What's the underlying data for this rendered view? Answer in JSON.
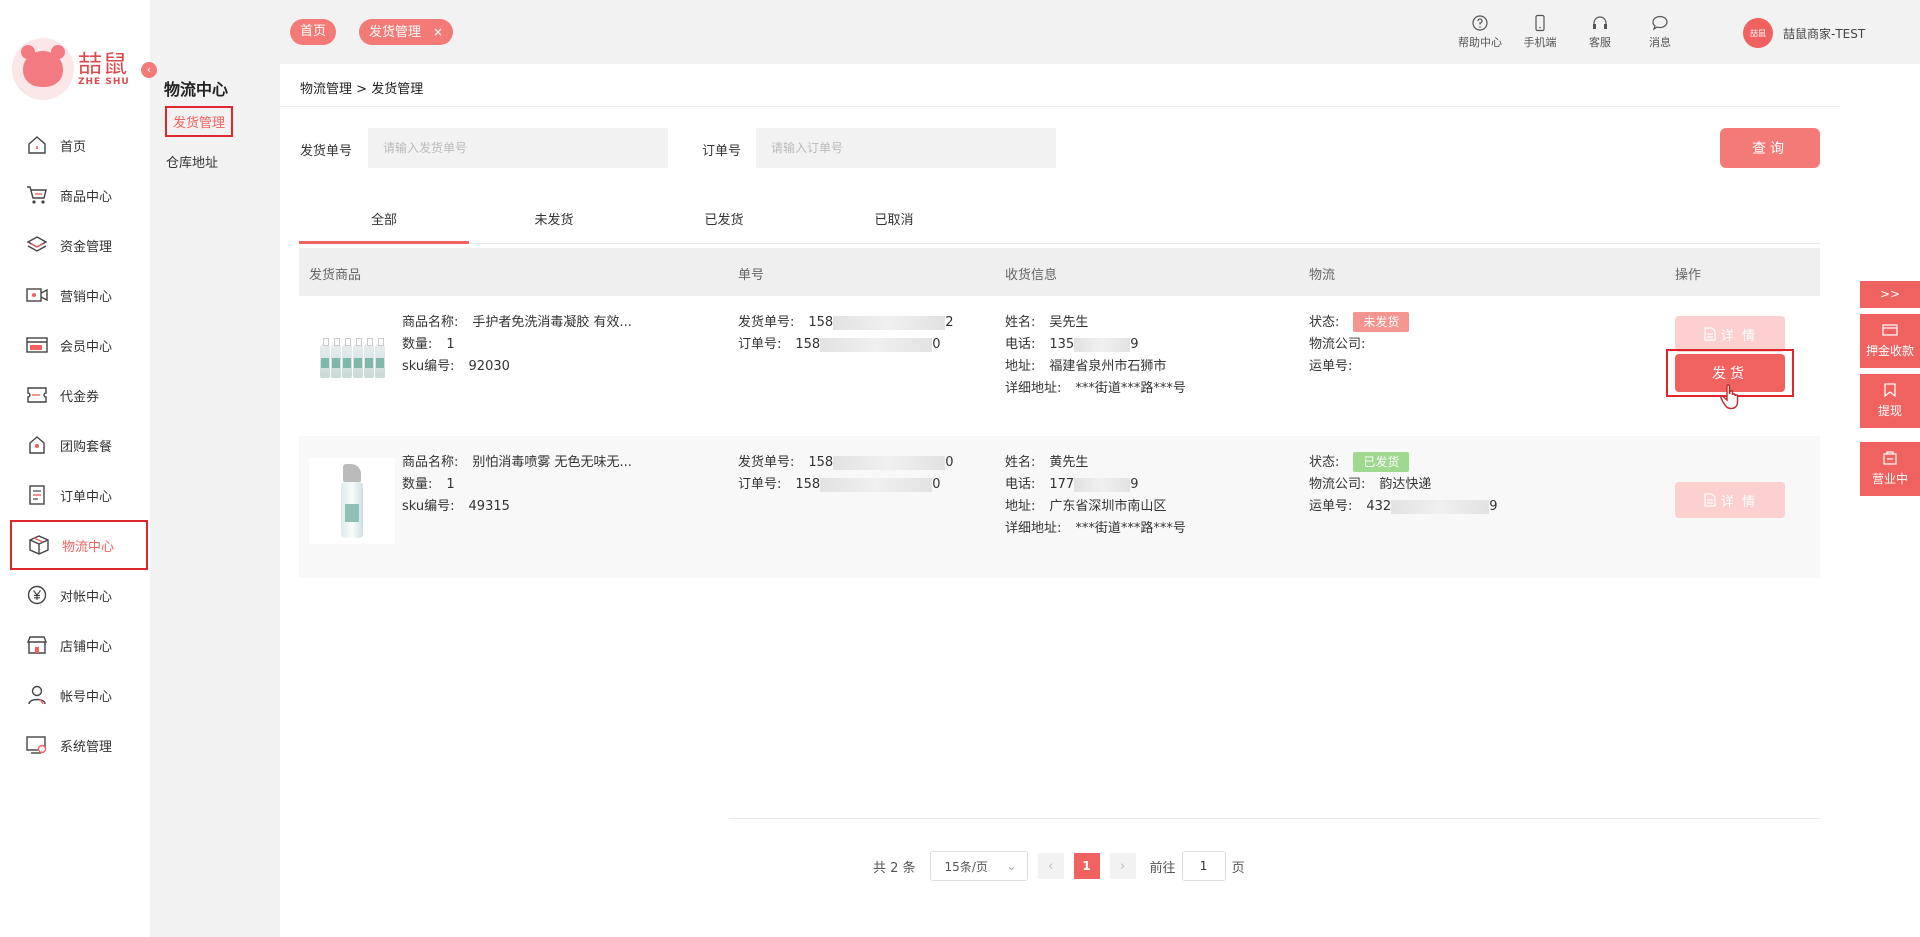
{
  "brand": {
    "cn": "喆鼠",
    "en": "ZHE SHU"
  },
  "sidebar": {
    "items": [
      {
        "label": "首页",
        "icon": "home-icon"
      },
      {
        "label": "商品中心",
        "icon": "cart-icon"
      },
      {
        "label": "资金管理",
        "icon": "layers-icon"
      },
      {
        "label": "营销中心",
        "icon": "camera-icon"
      },
      {
        "label": "会员中心",
        "icon": "vip-card-icon"
      },
      {
        "label": "代金券",
        "icon": "coupon-icon"
      },
      {
        "label": "团购套餐",
        "icon": "bag-icon"
      },
      {
        "label": "订单中心",
        "icon": "order-icon"
      },
      {
        "label": "物流中心",
        "icon": "box-icon"
      },
      {
        "label": "对帐中心",
        "icon": "yen-icon"
      },
      {
        "label": "店铺中心",
        "icon": "store-icon"
      },
      {
        "label": "帐号中心",
        "icon": "user-icon"
      },
      {
        "label": "系统管理",
        "icon": "settings-icon"
      }
    ],
    "active_index": 8
  },
  "submenu": {
    "title": "物流中心",
    "items": [
      "发货管理",
      "仓库地址"
    ],
    "active_index": 0
  },
  "topbar": {
    "tabs": [
      {
        "label": "首页"
      },
      {
        "label": "发货管理",
        "close": "×"
      }
    ],
    "actions": [
      {
        "label": "帮助中心",
        "icon": "help-icon"
      },
      {
        "label": "手机端",
        "icon": "phone-icon"
      },
      {
        "label": "客服",
        "icon": "headset-icon"
      },
      {
        "label": "消息",
        "icon": "message-icon"
      }
    ],
    "user": {
      "avatar_text": "喆鼠",
      "name": "喆鼠商家-TEST"
    }
  },
  "breadcrumb": {
    "parent": "物流管理",
    "sep": ">",
    "current": "发货管理"
  },
  "search": {
    "ship_no_label": "发货单号",
    "ship_no_placeholder": "请输入发货单号",
    "order_no_label": "订单号",
    "order_no_placeholder": "请输入订单号",
    "query_button": "查询"
  },
  "status_tabs": {
    "items": [
      "全部",
      "未发货",
      "已发货",
      "已取消"
    ],
    "active_index": 0
  },
  "table": {
    "headers": [
      "发货商品",
      "单号",
      "收货信息",
      "物流",
      "操作"
    ],
    "field_labels": {
      "product_name": "商品名称:",
      "quantity": "数量:",
      "sku": "sku编号:",
      "ship_no": "发货单号:",
      "order_no": "订单号:",
      "name": "姓名:",
      "phone": "电话:",
      "address": "地址:",
      "detail_address": "详细地址:",
      "status": "状态:",
      "company": "物流公司:",
      "tracking": "运单号:"
    },
    "rows": [
      {
        "product_name": "手护者免洗消毒凝胶 有效...",
        "quantity": "1",
        "sku": "92030",
        "ship_no_prefix": "158",
        "ship_no_suffix": "2",
        "order_no_prefix": "158",
        "order_no_suffix": "0",
        "name": "吴先生",
        "phone_prefix": "135",
        "phone_suffix": "9",
        "address": "福建省泉州市石狮市",
        "detail_address": "***街道***路***号",
        "status": "未发货",
        "company": "",
        "tracking_prefix": "",
        "tracking_suffix": "",
        "detail_button": "详 情",
        "ship_button": "发货"
      },
      {
        "product_name": "别怕消毒喷雾 无色无味无...",
        "quantity": "1",
        "sku": "49315",
        "ship_no_prefix": "158",
        "ship_no_suffix": "0",
        "order_no_prefix": "158",
        "order_no_suffix": "0",
        "name": "黄先生",
        "phone_prefix": "177",
        "phone_suffix": "9",
        "address": "广东省深圳市南山区",
        "detail_address": "***街道***路***号",
        "status": "已发货",
        "company": "韵达快递",
        "tracking_prefix": "432",
        "tracking_suffix": "9",
        "detail_button": "详 情"
      }
    ]
  },
  "pagination": {
    "total_text": "共 2 条",
    "page_size": "15条/页",
    "current_page": "1",
    "goto_label": "前往",
    "goto_value": "1",
    "page_unit": "页"
  },
  "right_float": {
    "toggle": ">>",
    "items": [
      {
        "label": "押金收款",
        "icon": "deposit-icon"
      },
      {
        "label": "提现",
        "icon": "withdraw-icon"
      },
      {
        "label": "营业中",
        "icon": "shop-open-icon"
      }
    ]
  },
  "colors": {
    "accent": "#f06260",
    "pending": "#f59590",
    "shipped": "#9fd98f",
    "highlight_border": "#e1262b"
  }
}
